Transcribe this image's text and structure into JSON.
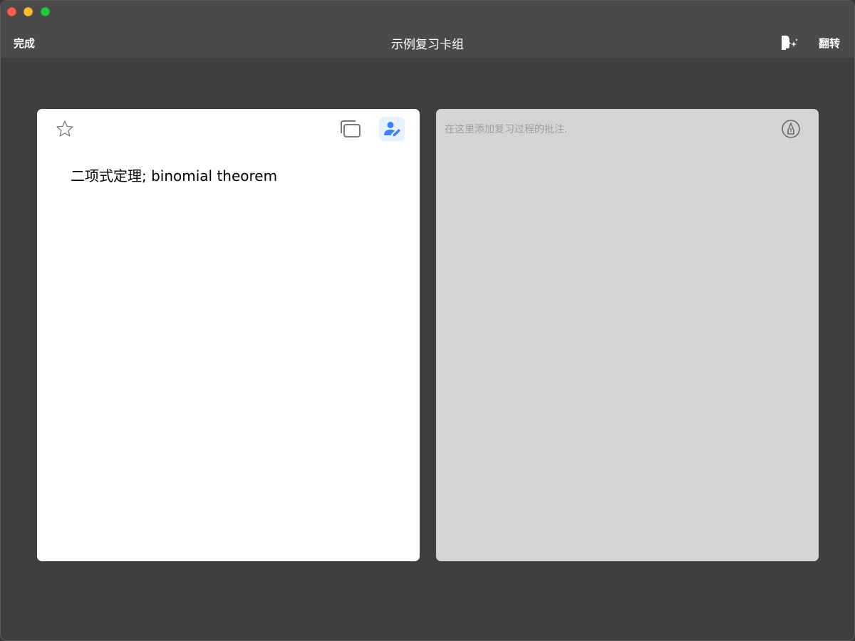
{
  "window": {
    "title": "示例复习卡组"
  },
  "toolbar": {
    "done_label": "完成",
    "flip_label": "翻转",
    "voice_icon": "speech-sparkle-icon"
  },
  "card": {
    "front_text": "二项式定理; binomial theorem",
    "star_icon": "star-outline-icon",
    "copy_icon": "copy-icon",
    "edit_icon": "person-edit-icon"
  },
  "notes": {
    "placeholder": "在这里添加复习过程的批注.",
    "pen_icon": "pencil-circle-icon"
  },
  "colors": {
    "accent": "#3b82f6",
    "edit_bg": "#e8f1fd",
    "window_bg": "#3f3f3f",
    "titlebar_bg": "#4a4a4a",
    "notes_bg": "#d4d4d4"
  }
}
